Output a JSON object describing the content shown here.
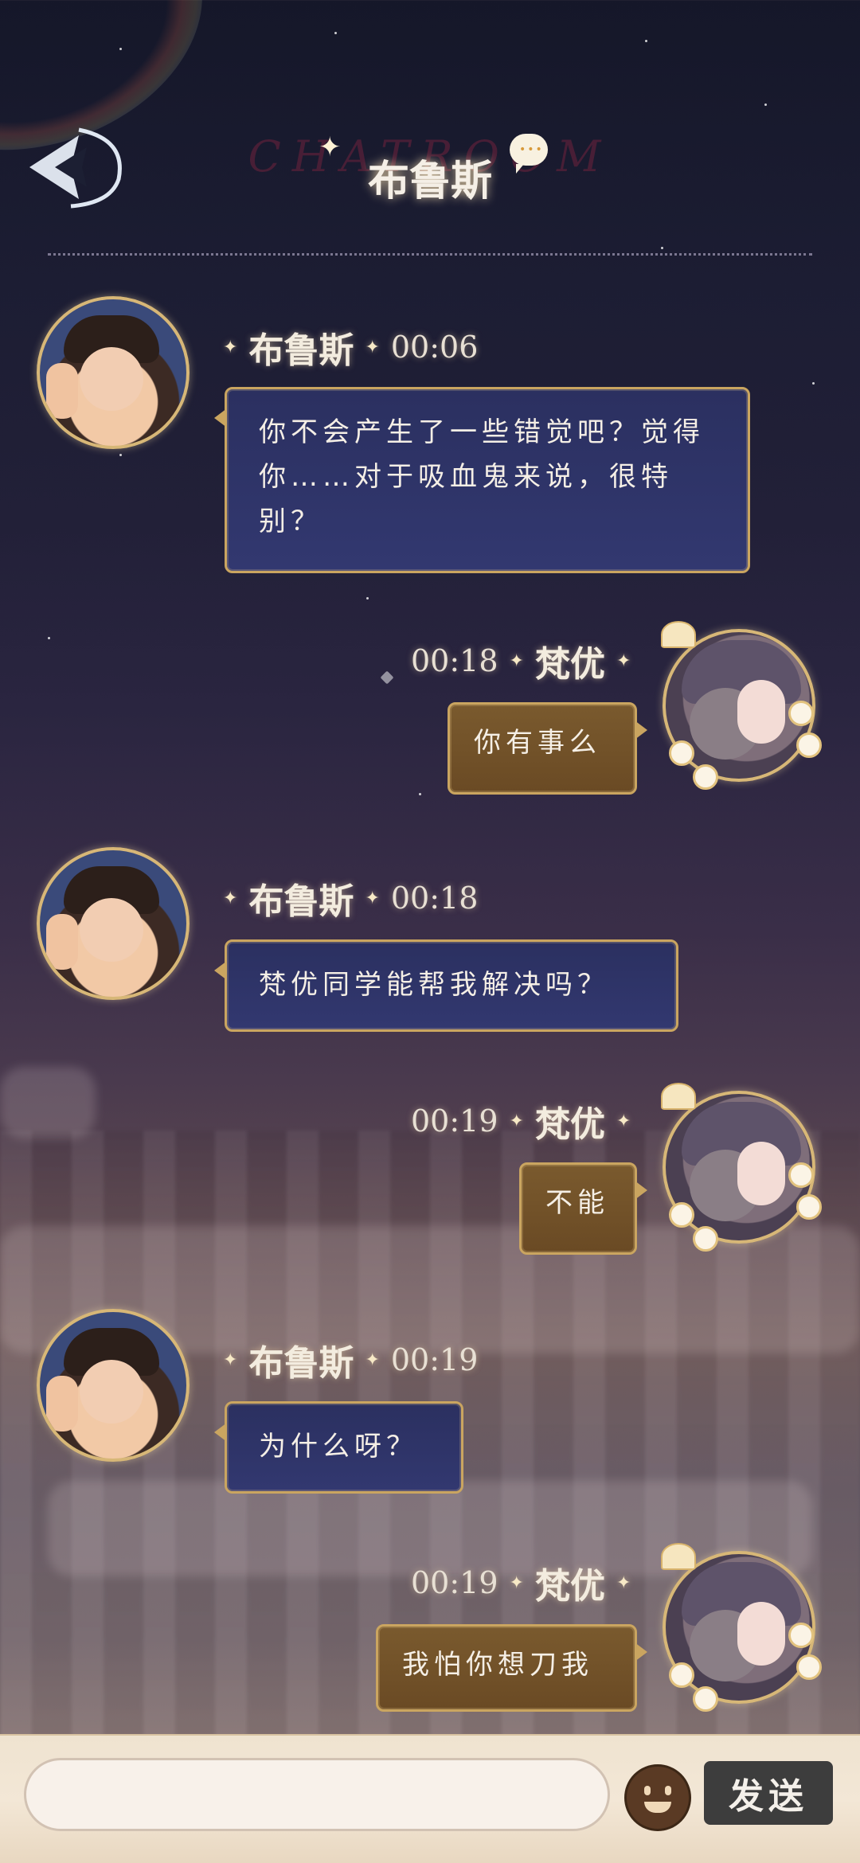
{
  "header": {
    "bg_text": "CHATROOM",
    "title": "布鲁斯"
  },
  "messages": [
    {
      "side": "left",
      "name": "布鲁斯",
      "time": "00:06",
      "text": "你不会产生了一些错觉吧？觉得你……对于吸血鬼来说，很特别？"
    },
    {
      "side": "right",
      "name": "梵优",
      "time": "00:18",
      "text": "你有事么"
    },
    {
      "side": "left",
      "name": "布鲁斯",
      "time": "00:18",
      "text": "梵优同学能帮我解决吗？"
    },
    {
      "side": "right",
      "name": "梵优",
      "time": "00:19",
      "text": "不能"
    },
    {
      "side": "left",
      "name": "布鲁斯",
      "time": "00:19",
      "text": "为什么呀？"
    },
    {
      "side": "right",
      "name": "梵优",
      "time": "00:19",
      "text": "我怕你想刀我"
    }
  ],
  "input": {
    "placeholder": "",
    "send_label": "发送"
  },
  "icons": {
    "back": "back-arrow-icon",
    "chat": "chat-bubble-icon",
    "emoji": "emoji-icon"
  },
  "colors": {
    "bubble_left": "#2e336a",
    "bubble_right": "#73532a",
    "bubble_border": "#caa560",
    "send_button": "#3d3d3d"
  }
}
